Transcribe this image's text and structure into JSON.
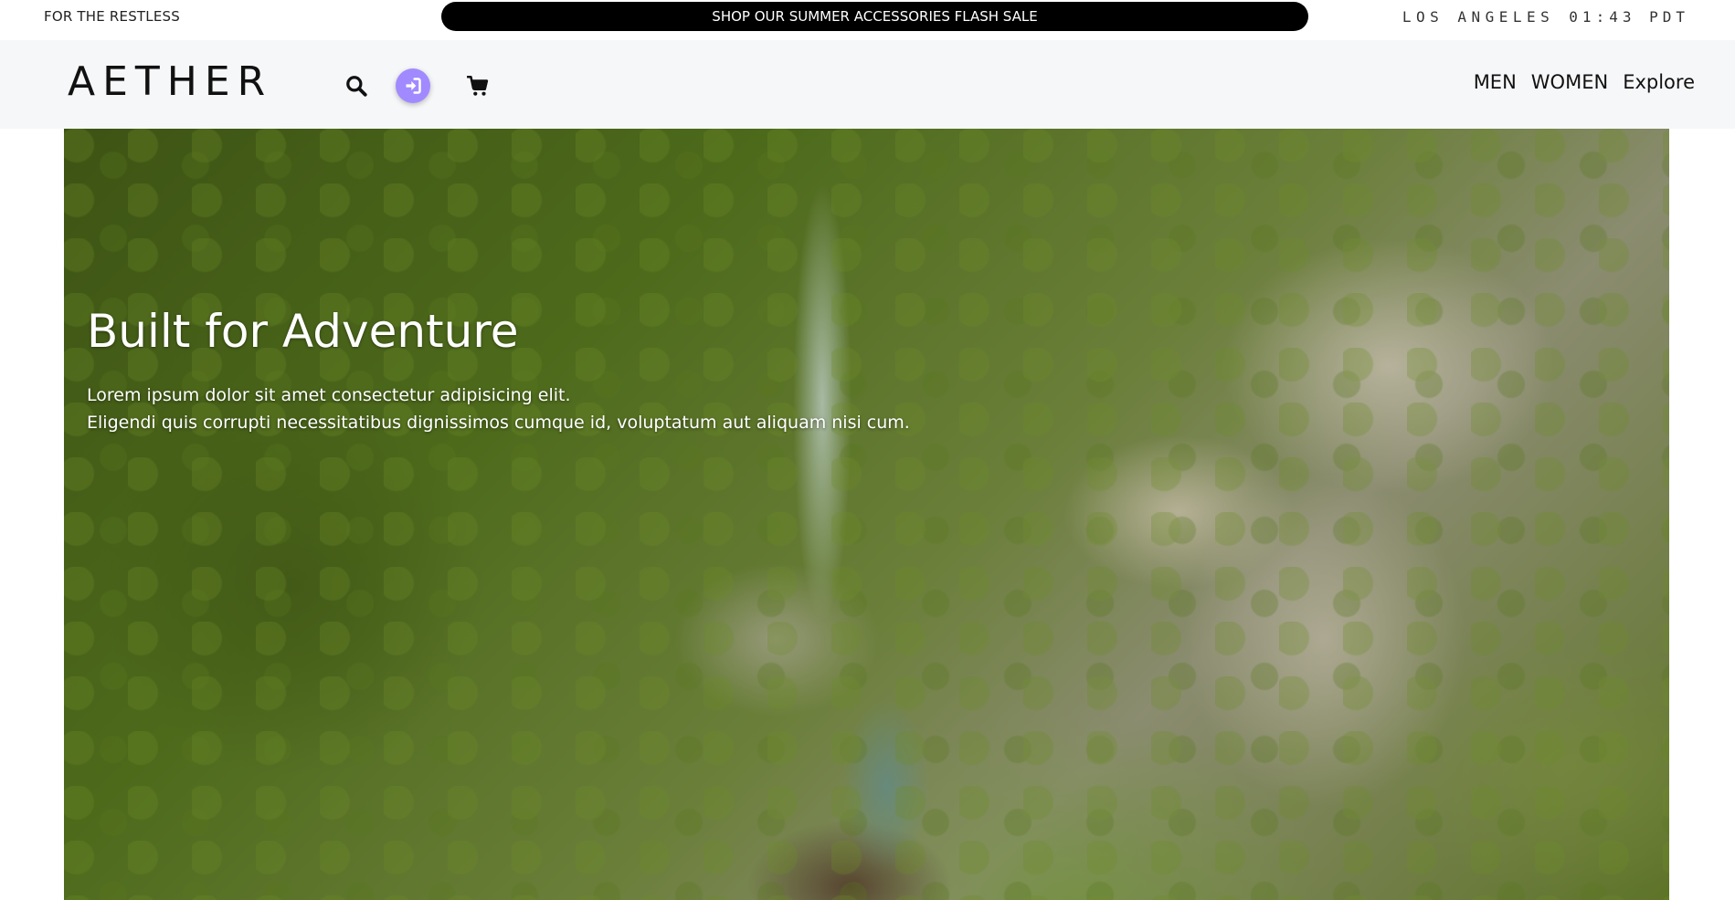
{
  "topbar": {
    "tagline": "FOR THE RESTLESS",
    "sale_banner": "SHOP OUR SUMMER ACCESSORIES FLASH SALE",
    "clock_city": "LOS ANGELES",
    "clock_time": "01:43 PDT"
  },
  "header": {
    "logo": "AETHER",
    "icons": [
      "search-icon",
      "sign-in-icon",
      "shopping-cart-icon"
    ],
    "nav": [
      "MEN",
      "WOMEN",
      "Explore"
    ]
  },
  "hero": {
    "title": "Built for Adventure",
    "body_line1": "Lorem ipsum dolor sit amet consectetur adipisicing elit.",
    "body_line2": "Eligendi quis corrupti necessitatibus dignissimos cumque id, voluptatum aut aliquam nisi cum.",
    "image_description": "aerial-forest-waterfall"
  },
  "colors": {
    "sale_banner_bg": "#000000",
    "login_accent": "#a18aff",
    "navbar_bg": "#f6f7f9"
  }
}
